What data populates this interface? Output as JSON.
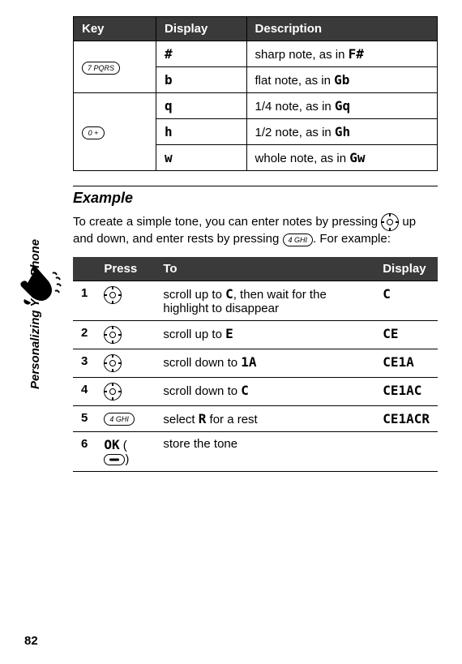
{
  "table1": {
    "headers": [
      "Key",
      "Display",
      "Description"
    ],
    "rows": [
      {
        "key": "7 PQRS",
        "display": "#",
        "desc_prefix": "sharp note, as in ",
        "desc_code": "F#",
        "rowspan": 2
      },
      {
        "key": "",
        "display": "b",
        "desc_prefix": "flat note, as in ",
        "desc_code": "Gb"
      },
      {
        "key": "0 +",
        "display": "q",
        "desc_prefix": "1/4 note, as in ",
        "desc_code": "Gq",
        "rowspan": 3
      },
      {
        "key": "",
        "display": "h",
        "desc_prefix": "1/2 note, as in ",
        "desc_code": "Gh"
      },
      {
        "key": "",
        "display": "w",
        "desc_prefix": "whole note, as in ",
        "desc_code": "Gw"
      }
    ]
  },
  "example_heading": "Example",
  "example_para_prefix": "To create a simple tone, you can enter notes by pressing ",
  "example_para_mid": " up and down, and enter rests by pressing ",
  "example_para_key2": "4 GHI",
  "example_para_suffix": ". For example:",
  "table2": {
    "headers": [
      "",
      "Press",
      "To",
      "Display"
    ],
    "rows": [
      {
        "n": "1",
        "press": "nav",
        "to_prefix": "scroll up to ",
        "to_code": "C",
        "to_suffix": ", then wait for the highlight to disappear",
        "display": "C"
      },
      {
        "n": "2",
        "press": "nav",
        "to_prefix": "scroll up to ",
        "to_code": "E",
        "to_suffix": "",
        "display": "CE"
      },
      {
        "n": "3",
        "press": "nav",
        "to_prefix": "scroll down to ",
        "to_code": "1A",
        "to_suffix": "",
        "display": "CE1A"
      },
      {
        "n": "4",
        "press": "nav",
        "to_prefix": "scroll down to ",
        "to_code": "C",
        "to_suffix": "",
        "display": "CE1AC"
      },
      {
        "n": "5",
        "press": "key4",
        "to_prefix": "select ",
        "to_code": "R",
        "to_suffix": " for a rest",
        "display": "CE1ACR"
      },
      {
        "n": "6",
        "press": "ok",
        "press_label": "OK",
        "to_prefix": "store the tone",
        "to_code": "",
        "to_suffix": "",
        "display": ""
      }
    ]
  },
  "key4_label": "4 GHI",
  "side_label": "Personalizing Your Phone",
  "page_number": "82"
}
